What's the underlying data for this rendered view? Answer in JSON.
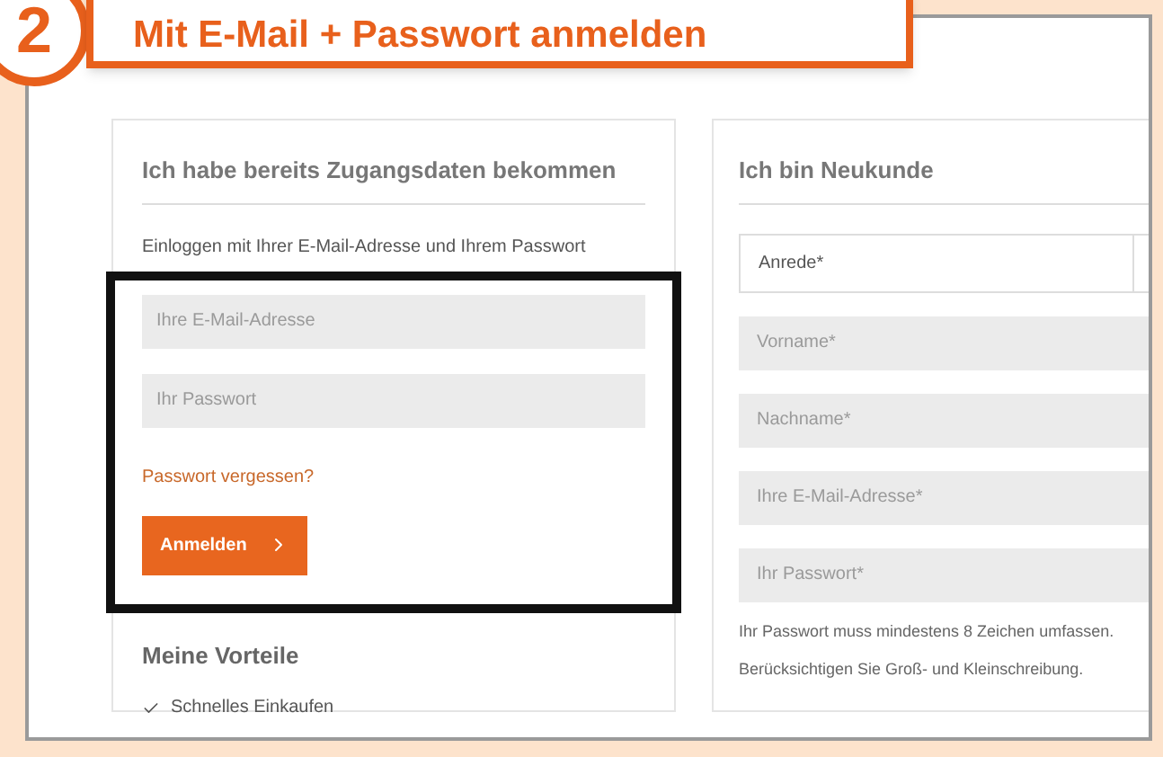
{
  "callout": {
    "number": "2",
    "title": "Mit E-Mail + Passwort anmelden"
  },
  "login": {
    "heading": "Ich habe bereits Zugangsdaten bekommen",
    "intro": "Einloggen mit Ihrer E-Mail-Adresse und Ihrem Passwort",
    "fields": [
      {
        "placeholder": "Ihre E-Mail-Adresse"
      },
      {
        "placeholder": "Ihr Passwort"
      }
    ],
    "forgot_link": "Passwort vergessen?",
    "submit_button": "Anmelden"
  },
  "benefits": {
    "heading": "Meine Vorteile",
    "items": [
      "Schnelles Einkaufen"
    ]
  },
  "register": {
    "heading": "Ich bin Neukunde",
    "salutation_select": {
      "value": "Anrede*"
    },
    "fields": [
      {
        "placeholder": "Vorname*"
      },
      {
        "placeholder": "Nachname*"
      },
      {
        "placeholder": "Ihre E-Mail-Adresse*"
      },
      {
        "placeholder": "Ihr Passwort*"
      }
    ],
    "hint_lines": [
      "Ihr Passwort muss mindestens 8 Zeichen umfassen.",
      "Berücksichtigen Sie Groß- und Kleinschreibung."
    ]
  }
}
